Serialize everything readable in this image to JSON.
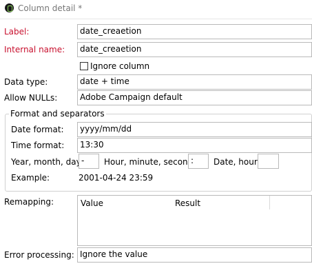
{
  "window": {
    "title": "Column detail *"
  },
  "label": {
    "label": "Label:",
    "value": "date_creaetion"
  },
  "internal_name": {
    "label": "Internal name:",
    "value": "date_creaetion"
  },
  "ignore_column": {
    "label": "Ignore column",
    "checked": false
  },
  "data_type": {
    "label": "Data type:",
    "value": "date + time"
  },
  "allow_nulls": {
    "label": "Allow NULLs:",
    "value": "Adobe Campaign default"
  },
  "format_group": {
    "legend": "Format and separators",
    "date_format": {
      "label": "Date format:",
      "value": "yyyy/mm/dd"
    },
    "time_format": {
      "label": "Time format:",
      "value": "13:30"
    },
    "ymd": {
      "label": "Year, month, day:",
      "value": "-"
    },
    "hms": {
      "label": "Hour, minute, second:",
      "value": ":"
    },
    "date_hour": {
      "label": "Date, hour:",
      "value": ""
    },
    "example": {
      "label": "Example:",
      "value": "2001-04-24 23:59"
    }
  },
  "remapping": {
    "label": "Remapping:",
    "columns": [
      "Value",
      "Result"
    ]
  },
  "error_processing": {
    "label": "Error processing:",
    "value": "Ignore the value"
  },
  "colors": {
    "required_label": "#c8102e",
    "border": "#b9b9b9"
  }
}
